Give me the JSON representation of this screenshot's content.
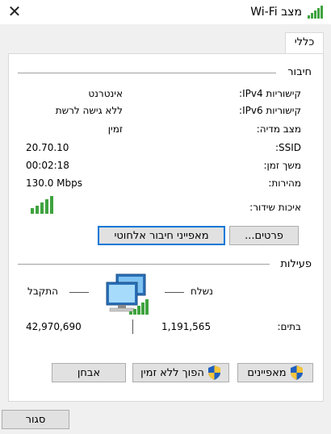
{
  "window": {
    "title": "מצב Wi-Fi",
    "close_icon": "close-icon",
    "title_icon": "wifi-signal-icon"
  },
  "tabs": [
    {
      "label": "כללי",
      "selected": true
    }
  ],
  "connection": {
    "heading": "חיבור",
    "rows": [
      {
        "label": "קישוריות IPv4:",
        "value": "אינטרנט"
      },
      {
        "label": "קישוריות IPv6:",
        "value": "ללא גישה לרשת"
      },
      {
        "label": "מצב מדיה:",
        "value": "זמין"
      },
      {
        "label": "SSID:",
        "value": "20.70.10"
      },
      {
        "label": "משך זמן:",
        "value": "00:02:18"
      },
      {
        "label": "מהירות:",
        "value": "130.0 Mbps"
      }
    ],
    "signal_label": "איכות שידור:",
    "signal_bars_lit": 5,
    "signal_bars_total": 5,
    "details_button": "פרטים...",
    "wireless_props_button": "מאפייני חיבור אלחוטי"
  },
  "activity": {
    "heading": "פעילות",
    "sent_label": "נשלח",
    "received_label": "התקבל",
    "bytes_label": "בתים:",
    "sent_bytes": "1,191,565",
    "received_bytes": "42,970,690"
  },
  "buttons": {
    "properties": "מאפיינים",
    "disable": "הפוך ללא זמין",
    "diagnose": "אבחן",
    "close": "סגור"
  },
  "colors": {
    "signal_green": "#3fa33f",
    "focus_blue": "#0078d7",
    "button_face": "#e1e1e1",
    "window_bg": "#f0f0f0"
  }
}
